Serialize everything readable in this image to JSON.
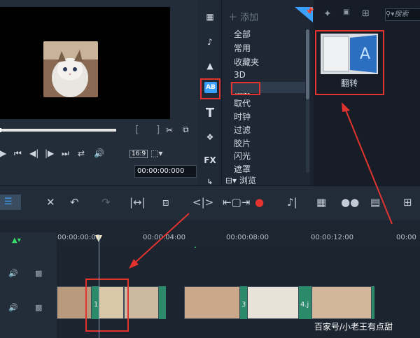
{
  "library": {
    "add_label": "添加",
    "search_placeholder": "搜索",
    "categories": [
      "全部",
      "常用",
      "收藏夹",
      "3D",
      "相册",
      "取代",
      "时钟",
      "过滤",
      "胶片",
      "闪光",
      "遮罩"
    ],
    "selected_category": "相册",
    "browse_label": "浏览",
    "fx_label": "FX",
    "ab_label": "AB"
  },
  "gallery": {
    "item_label": "翻转"
  },
  "preview": {
    "aspect_ratio": "16:9",
    "timecode": "00:00:00:000"
  },
  "timeline": {
    "ticks": [
      "00:00:00:00",
      "00:00:04:00",
      "00:00:08:00",
      "00:00:12:00",
      "00:00"
    ],
    "clip_numbers": [
      "1",
      "3",
      "4.j"
    ]
  },
  "watermark": "百家号/小老王有点甜",
  "colors": {
    "accent_blue": "#3aa0ff",
    "highlight_red": "#e2332f",
    "transition_green": "#2a8a6a"
  }
}
